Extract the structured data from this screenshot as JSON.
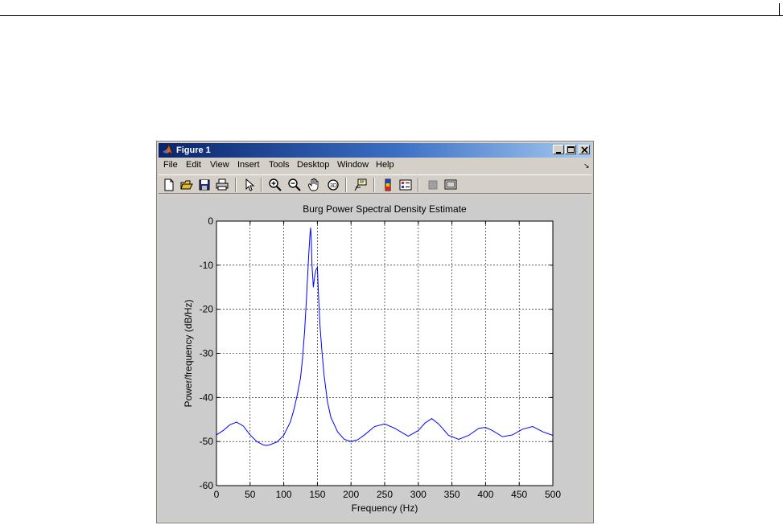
{
  "window": {
    "title": "Figure 1"
  },
  "menu": {
    "items": [
      "File",
      "Edit",
      "View",
      "Insert",
      "Tools",
      "Desktop",
      "Window",
      "Help"
    ]
  },
  "toolbar": {
    "icons": [
      "new-file-icon",
      "open-folder-icon",
      "save-icon",
      "print-icon",
      "pointer-icon",
      "zoom-in-icon",
      "zoom-out-icon",
      "pan-hand-icon",
      "rotate-3d-icon",
      "data-cursor-icon",
      "colorbar-icon",
      "legend-icon",
      "hide-plot-tools-icon",
      "show-plot-tools-icon"
    ]
  },
  "colors": {
    "title_bar_start": "#0a246a",
    "title_bar_end": "#a6caf0",
    "line": "#0000ff",
    "figure_bg": "#cccccc"
  },
  "chart_data": {
    "type": "line",
    "title": "Burg Power Spectral Density Estimate",
    "xlabel": "Frequency (Hz)",
    "ylabel": "Power/frequency (dB/Hz)",
    "xlim": [
      0,
      500
    ],
    "ylim": [
      -60,
      0
    ],
    "xticks": [
      0,
      50,
      100,
      150,
      200,
      250,
      300,
      350,
      400,
      450,
      500
    ],
    "yticks": [
      0,
      -10,
      -20,
      -30,
      -40,
      -50,
      -60
    ],
    "grid": true,
    "series": [
      {
        "color": "#0000ff",
        "x": [
          0,
          10,
          20,
          30,
          40,
          50,
          60,
          70,
          75,
          80,
          90,
          100,
          110,
          115,
          120,
          125,
          128,
          131,
          134,
          137,
          139,
          140,
          141,
          142,
          144,
          146,
          148,
          150,
          152,
          154,
          157,
          160,
          165,
          170,
          180,
          190,
          200,
          210,
          220,
          235,
          250,
          265,
          285,
          300,
          310,
          320,
          330,
          345,
          360,
          375,
          390,
          400,
          410,
          425,
          440,
          455,
          470,
          485,
          500
        ],
        "y": [
          -48.5,
          -47.5,
          -46.2,
          -45.6,
          -46.5,
          -48.5,
          -50.0,
          -50.8,
          -50.9,
          -50.7,
          -50.1,
          -48.6,
          -45.5,
          -42.8,
          -39.5,
          -35.5,
          -31.0,
          -25.0,
          -17.0,
          -8.0,
          -3.0,
          -1.5,
          -4.5,
          -10.0,
          -15.0,
          -12.5,
          -11.0,
          -10.5,
          -18.0,
          -24.0,
          -30.0,
          -35.0,
          -41.0,
          -44.5,
          -47.8,
          -49.5,
          -50.0,
          -49.6,
          -48.5,
          -46.6,
          -46.0,
          -47.0,
          -48.8,
          -47.5,
          -45.8,
          -44.8,
          -46.0,
          -48.6,
          -49.5,
          -48.6,
          -47.0,
          -46.8,
          -47.5,
          -48.9,
          -48.5,
          -47.2,
          -46.6,
          -47.8,
          -48.6
        ]
      }
    ]
  }
}
